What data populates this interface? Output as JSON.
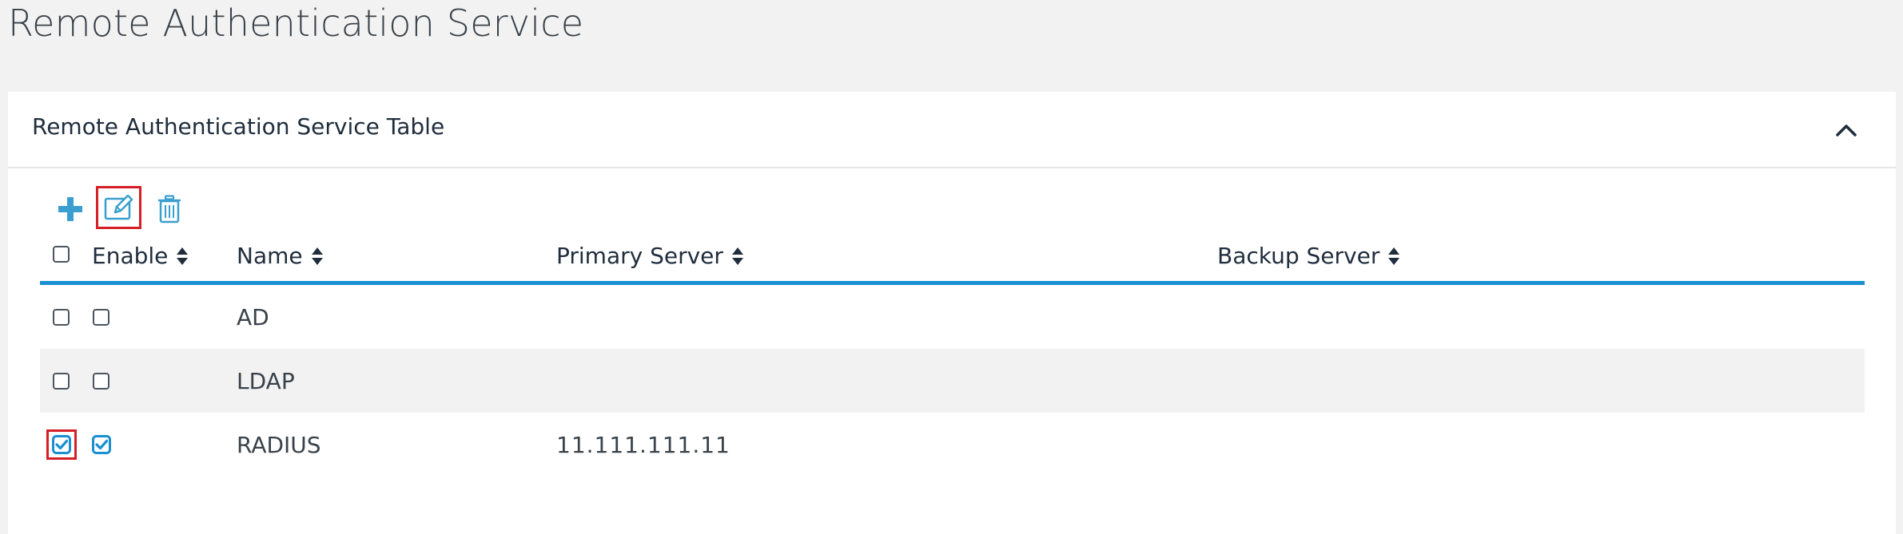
{
  "page": {
    "title": "Remote Authentication Service"
  },
  "panel": {
    "title": "Remote Authentication Service Table",
    "collapse_icon": "chevron-up-icon"
  },
  "toolbar": {
    "add_icon": "plus-icon",
    "edit_icon": "edit-icon",
    "delete_icon": "trash-icon"
  },
  "table": {
    "columns": [
      {
        "key": "enable",
        "label": "Enable"
      },
      {
        "key": "name",
        "label": "Name"
      },
      {
        "key": "primary_server",
        "label": "Primary Server"
      },
      {
        "key": "backup_server",
        "label": "Backup Server"
      }
    ],
    "header_select_all_checked": false,
    "rows": [
      {
        "selected": false,
        "enabled": false,
        "name": "AD",
        "primary_server": "",
        "backup_server": ""
      },
      {
        "selected": false,
        "enabled": false,
        "name": "LDAP",
        "primary_server": "",
        "backup_server": ""
      },
      {
        "selected": true,
        "enabled": true,
        "name": "RADIUS",
        "primary_server": "11.111.111.11",
        "backup_server": ""
      }
    ]
  },
  "colors": {
    "accent": "#1a8fd4",
    "icon_blue": "#3a9fd0",
    "highlight_red": "#d51f26",
    "row_alt": "#f2f2f2",
    "page_bg": "#f2f2f2"
  }
}
